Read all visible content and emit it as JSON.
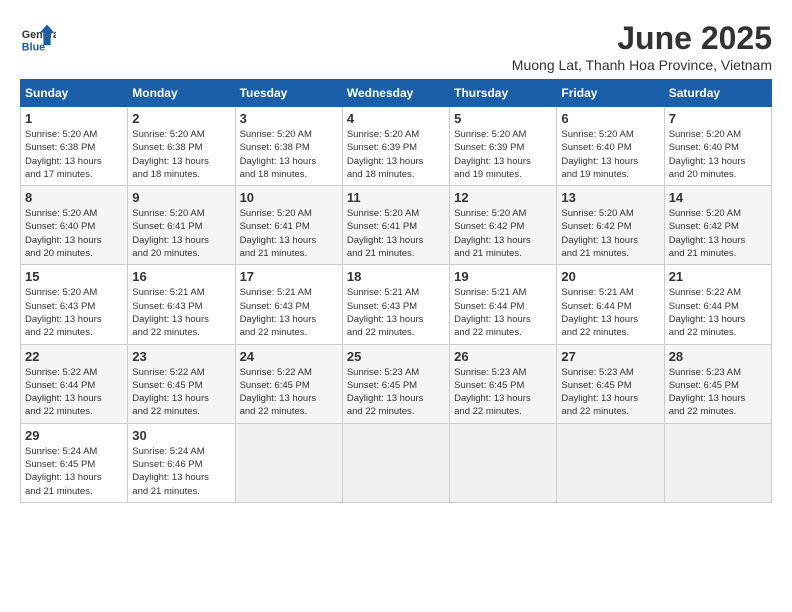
{
  "logo": {
    "line1": "General",
    "line2": "Blue"
  },
  "title": "June 2025",
  "subtitle": "Muong Lat, Thanh Hoa Province, Vietnam",
  "days_header": [
    "Sunday",
    "Monday",
    "Tuesday",
    "Wednesday",
    "Thursday",
    "Friday",
    "Saturday"
  ],
  "weeks": [
    [
      {
        "day": "1",
        "info": "Sunrise: 5:20 AM\nSunset: 6:38 PM\nDaylight: 13 hours\nand 17 minutes."
      },
      {
        "day": "2",
        "info": "Sunrise: 5:20 AM\nSunset: 6:38 PM\nDaylight: 13 hours\nand 18 minutes."
      },
      {
        "day": "3",
        "info": "Sunrise: 5:20 AM\nSunset: 6:38 PM\nDaylight: 13 hours\nand 18 minutes."
      },
      {
        "day": "4",
        "info": "Sunrise: 5:20 AM\nSunset: 6:39 PM\nDaylight: 13 hours\nand 18 minutes."
      },
      {
        "day": "5",
        "info": "Sunrise: 5:20 AM\nSunset: 6:39 PM\nDaylight: 13 hours\nand 19 minutes."
      },
      {
        "day": "6",
        "info": "Sunrise: 5:20 AM\nSunset: 6:40 PM\nDaylight: 13 hours\nand 19 minutes."
      },
      {
        "day": "7",
        "info": "Sunrise: 5:20 AM\nSunset: 6:40 PM\nDaylight: 13 hours\nand 20 minutes."
      }
    ],
    [
      {
        "day": "8",
        "info": "Sunrise: 5:20 AM\nSunset: 6:40 PM\nDaylight: 13 hours\nand 20 minutes."
      },
      {
        "day": "9",
        "info": "Sunrise: 5:20 AM\nSunset: 6:41 PM\nDaylight: 13 hours\nand 20 minutes."
      },
      {
        "day": "10",
        "info": "Sunrise: 5:20 AM\nSunset: 6:41 PM\nDaylight: 13 hours\nand 21 minutes."
      },
      {
        "day": "11",
        "info": "Sunrise: 5:20 AM\nSunset: 6:41 PM\nDaylight: 13 hours\nand 21 minutes."
      },
      {
        "day": "12",
        "info": "Sunrise: 5:20 AM\nSunset: 6:42 PM\nDaylight: 13 hours\nand 21 minutes."
      },
      {
        "day": "13",
        "info": "Sunrise: 5:20 AM\nSunset: 6:42 PM\nDaylight: 13 hours\nand 21 minutes."
      },
      {
        "day": "14",
        "info": "Sunrise: 5:20 AM\nSunset: 6:42 PM\nDaylight: 13 hours\nand 21 minutes."
      }
    ],
    [
      {
        "day": "15",
        "info": "Sunrise: 5:20 AM\nSunset: 6:43 PM\nDaylight: 13 hours\nand 22 minutes."
      },
      {
        "day": "16",
        "info": "Sunrise: 5:21 AM\nSunset: 6:43 PM\nDaylight: 13 hours\nand 22 minutes."
      },
      {
        "day": "17",
        "info": "Sunrise: 5:21 AM\nSunset: 6:43 PM\nDaylight: 13 hours\nand 22 minutes."
      },
      {
        "day": "18",
        "info": "Sunrise: 5:21 AM\nSunset: 6:43 PM\nDaylight: 13 hours\nand 22 minutes."
      },
      {
        "day": "19",
        "info": "Sunrise: 5:21 AM\nSunset: 6:44 PM\nDaylight: 13 hours\nand 22 minutes."
      },
      {
        "day": "20",
        "info": "Sunrise: 5:21 AM\nSunset: 6:44 PM\nDaylight: 13 hours\nand 22 minutes."
      },
      {
        "day": "21",
        "info": "Sunrise: 5:22 AM\nSunset: 6:44 PM\nDaylight: 13 hours\nand 22 minutes."
      }
    ],
    [
      {
        "day": "22",
        "info": "Sunrise: 5:22 AM\nSunset: 6:44 PM\nDaylight: 13 hours\nand 22 minutes."
      },
      {
        "day": "23",
        "info": "Sunrise: 5:22 AM\nSunset: 6:45 PM\nDaylight: 13 hours\nand 22 minutes."
      },
      {
        "day": "24",
        "info": "Sunrise: 5:22 AM\nSunset: 6:45 PM\nDaylight: 13 hours\nand 22 minutes."
      },
      {
        "day": "25",
        "info": "Sunrise: 5:23 AM\nSunset: 6:45 PM\nDaylight: 13 hours\nand 22 minutes."
      },
      {
        "day": "26",
        "info": "Sunrise: 5:23 AM\nSunset: 6:45 PM\nDaylight: 13 hours\nand 22 minutes."
      },
      {
        "day": "27",
        "info": "Sunrise: 5:23 AM\nSunset: 6:45 PM\nDaylight: 13 hours\nand 22 minutes."
      },
      {
        "day": "28",
        "info": "Sunrise: 5:23 AM\nSunset: 6:45 PM\nDaylight: 13 hours\nand 22 minutes."
      }
    ],
    [
      {
        "day": "29",
        "info": "Sunrise: 5:24 AM\nSunset: 6:45 PM\nDaylight: 13 hours\nand 21 minutes."
      },
      {
        "day": "30",
        "info": "Sunrise: 5:24 AM\nSunset: 6:46 PM\nDaylight: 13 hours\nand 21 minutes."
      },
      null,
      null,
      null,
      null,
      null
    ]
  ]
}
